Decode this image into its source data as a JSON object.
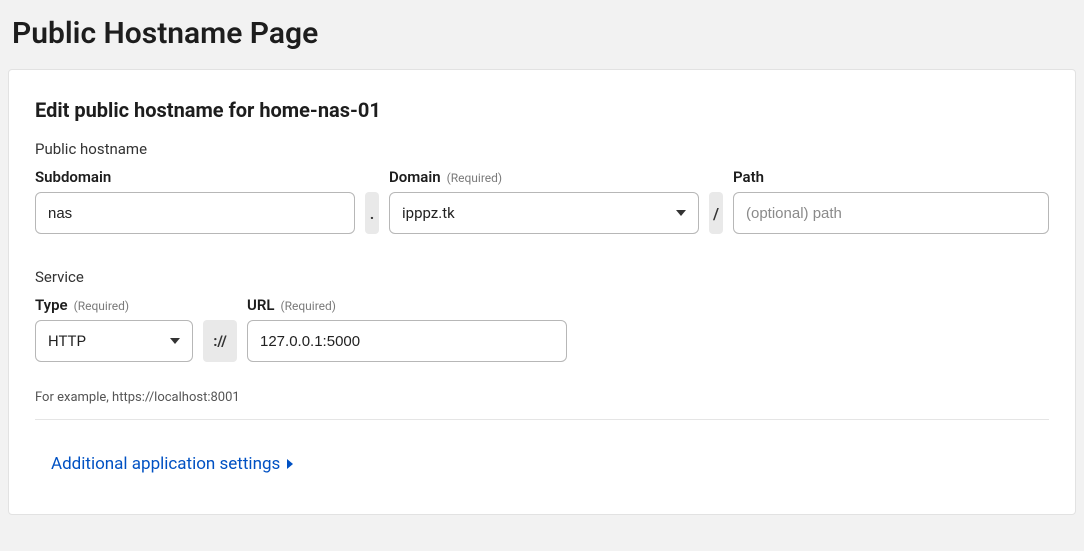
{
  "header": {
    "title": "Public Hostname Page"
  },
  "card": {
    "title": "Edit public hostname for home-nas-01",
    "hostname_section_label": "Public hostname",
    "subdomain_label": "Subdomain",
    "subdomain_value": "nas",
    "domain_label": "Domain",
    "domain_required": "(Required)",
    "domain_value": "ipppz.tk",
    "path_label": "Path",
    "path_placeholder": "(optional) path",
    "path_value": "",
    "dot": ".",
    "slash": "/",
    "service_section_label": "Service",
    "type_label": "Type",
    "type_required": "(Required)",
    "type_value": "HTTP",
    "url_label": "URL",
    "url_required": "(Required)",
    "url_value": "127.0.0.1:5000",
    "proto_sep": "://",
    "example_text": "For example, https://localhost:8001",
    "expand_label": "Additional application settings"
  }
}
